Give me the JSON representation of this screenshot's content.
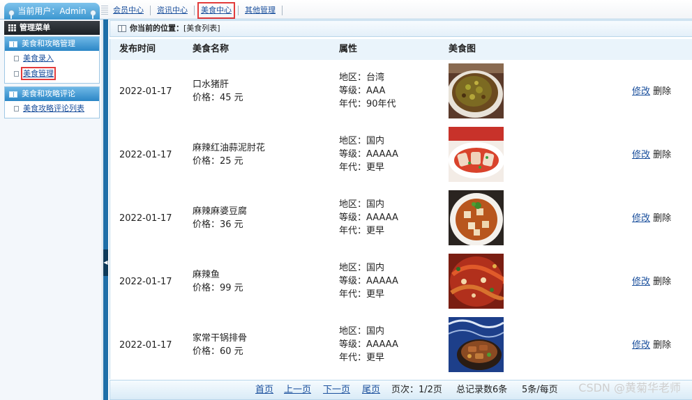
{
  "header": {
    "current_user": "当前用户：Admin",
    "nav": [
      "会员中心",
      "资讯中心",
      "美食中心",
      "其他管理"
    ],
    "active_nav": "美食中心"
  },
  "sidebar": {
    "title": "管理菜单",
    "groups": [
      {
        "title": "美食和攻略管理",
        "items": [
          "美食录入",
          "美食管理"
        ]
      },
      {
        "title": "美食和攻略评论",
        "items": [
          "美食攻略评论列表"
        ]
      }
    ],
    "active_item": "美食管理"
  },
  "breadcrumb": {
    "label": "你当前的位置：",
    "value": "[美食列表]"
  },
  "table": {
    "headers": [
      "发布时间",
      "美食名称",
      "属性",
      "美食图"
    ],
    "rows": [
      {
        "date": "2022-01-17",
        "name": "口水猪肝",
        "price": "价格：45 元",
        "region": "地区：台湾",
        "level": "等级：AAA",
        "era": "年代：90年代",
        "image": "mouthwatering-pork-liver-photo"
      },
      {
        "date": "2022-01-17",
        "name": "麻辣红油蒜泥肘花",
        "price": "价格：25 元",
        "region": "地区：国内",
        "level": "等级：AAAAA",
        "era": "年代：更早",
        "image": "spicy-pork-knuckle-photo"
      },
      {
        "date": "2022-01-17",
        "name": "麻辣麻婆豆腐",
        "price": "价格：36 元",
        "region": "地区：国内",
        "level": "等级：AAAAA",
        "era": "年代：更早",
        "image": "mapo-tofu-photo"
      },
      {
        "date": "2022-01-17",
        "name": "麻辣鱼",
        "price": "价格：99 元",
        "region": "地区：国内",
        "level": "等级：AAAAA",
        "era": "年代：更早",
        "image": "spicy-fish-photo"
      },
      {
        "date": "2022-01-17",
        "name": "家常干锅排骨",
        "price": "价格：60 元",
        "region": "地区：国内",
        "level": "等级：AAAAA",
        "era": "年代：更早",
        "image": "dry-pot-ribs-photo"
      }
    ],
    "actions": {
      "edit": "修改",
      "delete": "删除"
    }
  },
  "pager": {
    "first": "首页",
    "prev": "上一页",
    "next": "下一页",
    "last": "尾页",
    "page_info": "页次：1/2页",
    "total": "总记录数6条",
    "per_page": "5条/每页"
  },
  "watermark": "CSDN @黄菊华老师",
  "colors": {
    "accent_blue": "#2b86c6",
    "highlight_red": "#e23b3b",
    "link": "#1a4f9c"
  }
}
